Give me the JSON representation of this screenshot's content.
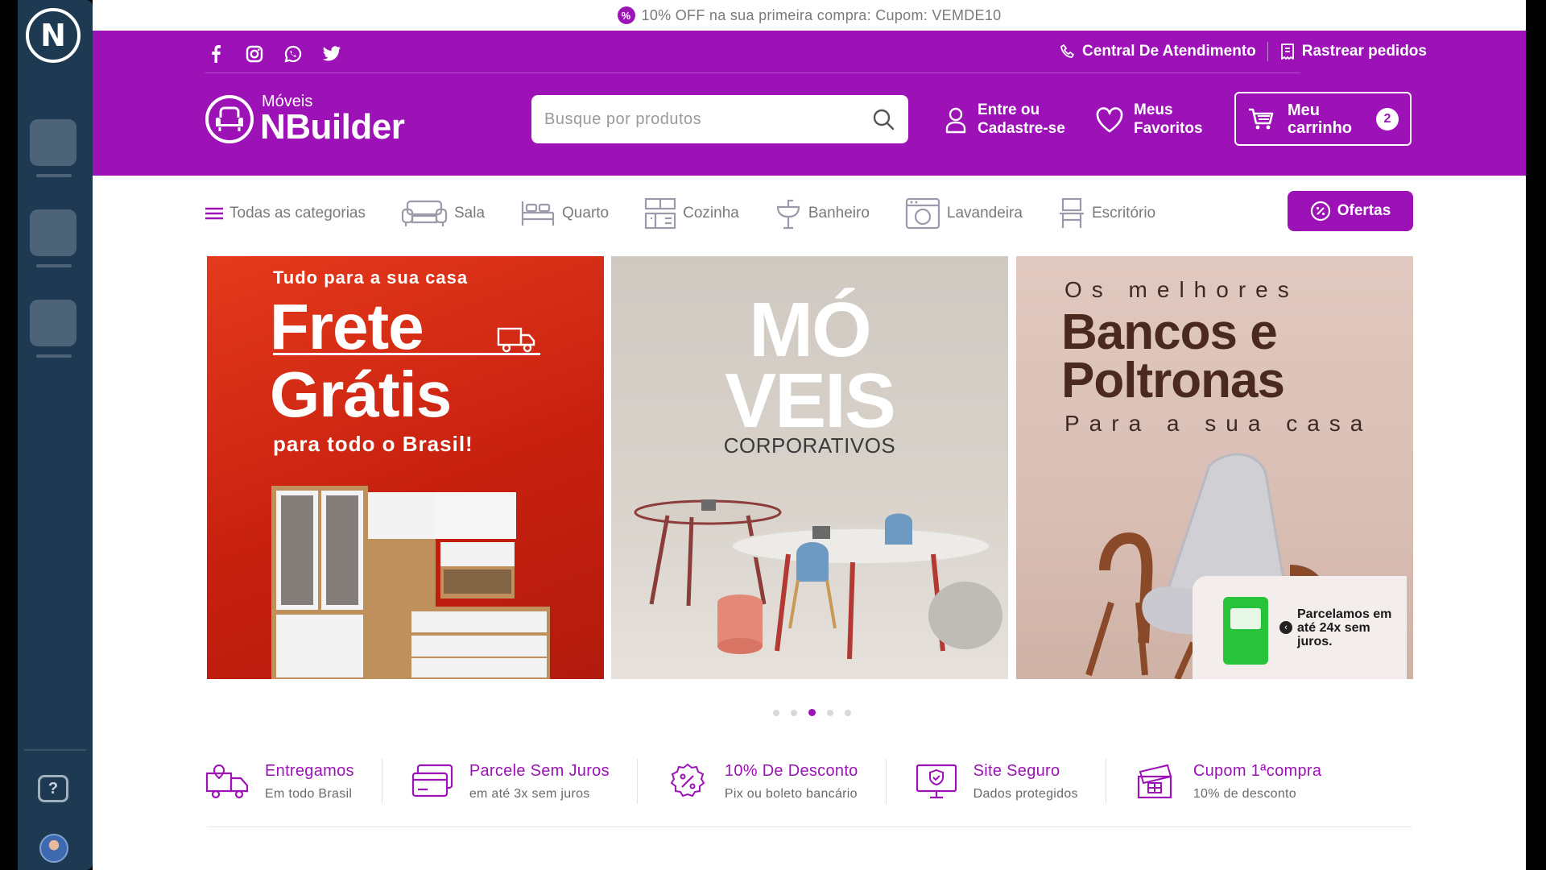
{
  "promo": {
    "text": "10% OFF na sua primeira compra: Cupom: VEMDE10"
  },
  "header": {
    "social_icons": [
      "facebook-icon",
      "instagram-icon",
      "whatsapp-icon",
      "twitter-icon"
    ],
    "support_link": "Central De Atendimento",
    "track_link": "Rastrear pedidos",
    "brand_small": "Móveis",
    "brand_big": "NBuilder",
    "search_placeholder": "Busque por produtos",
    "login_line1": "Entre ou",
    "login_line2": "Cadastre-se",
    "fav_line1": "Meus",
    "fav_line2": "Favoritos",
    "cart_line1": "Meu",
    "cart_line2": "carrinho",
    "cart_count": "2"
  },
  "nav": {
    "all_categories": "Todas as categorias",
    "items": [
      "Sala",
      "Quarto",
      "Cozinha",
      "Banheiro",
      "Lavandeira",
      "Escritório"
    ],
    "offers": "Ofertas"
  },
  "banners": {
    "b1": {
      "line1": "Tudo para a sua casa",
      "line2": "Frete",
      "line3": "Grátis",
      "line4": "para todo o Brasil!"
    },
    "b2": {
      "line1": "MÓ",
      "line2": "VEIS",
      "line3": "CORPORATIVOS"
    },
    "b3": {
      "line1": "Os melhores",
      "line2": "Bancos e",
      "line3": "Poltronas",
      "line4": "Para a sua casa",
      "card": "Parcelamos em até 24x sem juros."
    }
  },
  "carousel": {
    "count": 5,
    "active": 3
  },
  "features": [
    {
      "title": "Entregamos",
      "sub": "Em todo Brasil",
      "icon": "truck-icon"
    },
    {
      "title": "Parcele Sem Juros",
      "sub": "em até 3x sem juros",
      "icon": "credit-card-icon"
    },
    {
      "title": "10% De Desconto",
      "sub": "Pix ou boleto bancário",
      "icon": "percent-icon"
    },
    {
      "title": "Site Seguro",
      "sub": "Dados protegidos",
      "icon": "secure-monitor-icon"
    },
    {
      "title": "Cupom 1ªcompra",
      "sub": "10% de desconto",
      "icon": "coupon-icon"
    }
  ],
  "colors": {
    "brand": "#9c12b7",
    "rail": "#1e3a52"
  }
}
